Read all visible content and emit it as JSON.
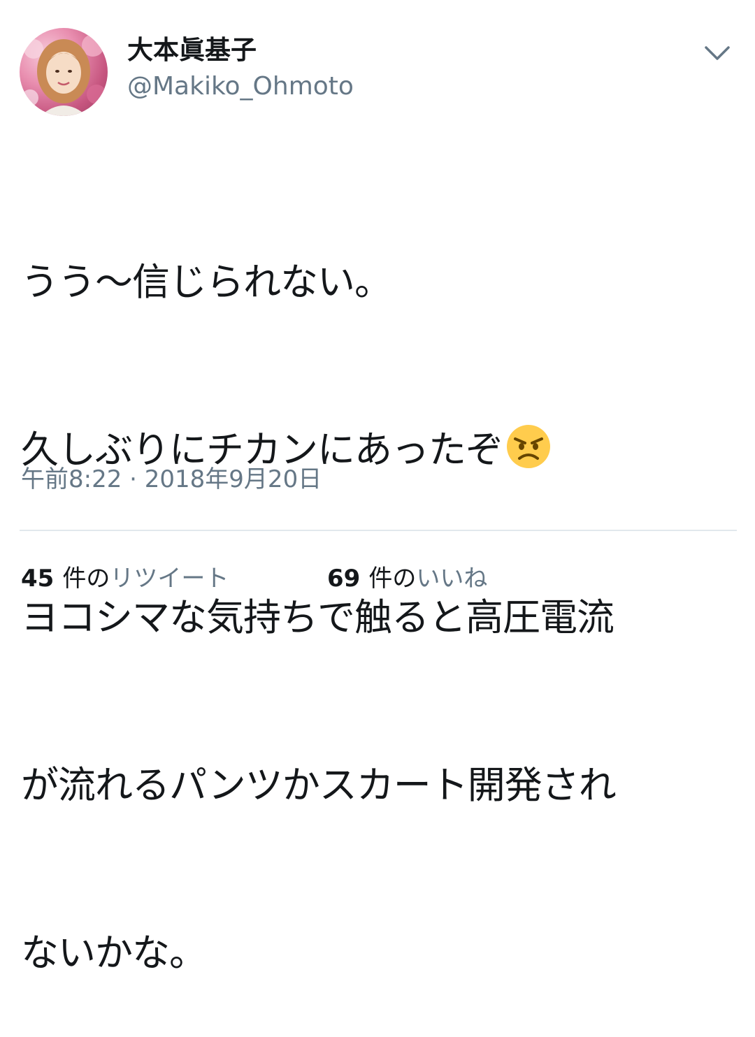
{
  "tweet": {
    "author": {
      "display_name": "大本眞基子",
      "handle": "@Makiko_Ohmoto"
    },
    "menu_icon": "chevron-down-icon",
    "text_lines": [
      "うう～信じられない。",
      "久しぶりにチカンにあったぞ",
      "ヨコシマな気持ちで触ると高圧電流",
      "が流れるパンツかスカート開発され",
      "ないかな。"
    ],
    "emoji": "angry-face-emoji",
    "timestamp": "午前8:22 · 2018年9月20日",
    "stats": {
      "retweets": {
        "count": "45",
        "label_prefix": "件の",
        "label": "リツイート"
      },
      "likes": {
        "count": "69",
        "label_prefix": "件の",
        "label": "いいね"
      }
    }
  },
  "colors": {
    "text_primary": "#14171a",
    "text_secondary": "#657786",
    "divider": "#e1e8ed",
    "emoji_yellow": "#ffcc4d"
  }
}
